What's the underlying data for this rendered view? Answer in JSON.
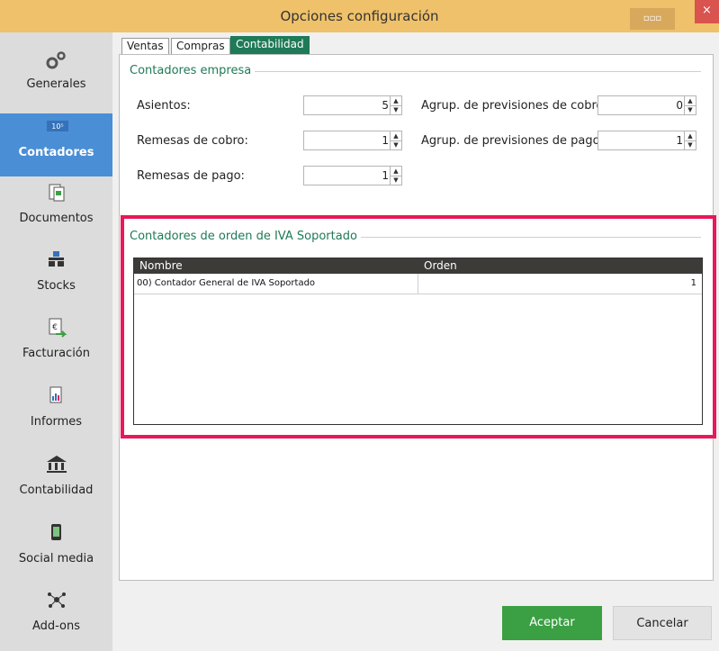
{
  "window": {
    "title": "Opciones configuración",
    "close_glyph": "×",
    "minimize_glyph": "▫▫▫"
  },
  "sidebar": {
    "items": [
      {
        "label": "Generales",
        "icon": "gears-icon"
      },
      {
        "label": "Contadores",
        "icon": "counter-icon",
        "active": true
      },
      {
        "label": "Documentos",
        "icon": "documents-icon"
      },
      {
        "label": "Stocks",
        "icon": "stocks-icon"
      },
      {
        "label": "Facturación",
        "icon": "invoice-icon"
      },
      {
        "label": "Informes",
        "icon": "report-icon"
      },
      {
        "label": "Contabilidad",
        "icon": "bank-icon"
      },
      {
        "label": "Social media",
        "icon": "phone-icon"
      },
      {
        "label": "Add-ons",
        "icon": "network-icon"
      }
    ],
    "counter_icon_text": "10⁵"
  },
  "tabs": [
    {
      "label": "Ventas",
      "active": false
    },
    {
      "label": "Compras",
      "active": false
    },
    {
      "label": "Contabilidad",
      "active": true
    }
  ],
  "contadores_empresa": {
    "title": "Contadores empresa",
    "fields": {
      "asientos": {
        "label": "Asientos:",
        "value": "5"
      },
      "remesas_cobro": {
        "label": "Remesas de cobro:",
        "value": "1"
      },
      "remesas_pago": {
        "label": "Remesas de pago:",
        "value": "1"
      },
      "agrup_cobro": {
        "label": "Agrup. de previsiones de cobro:",
        "value": "0"
      },
      "agrup_pago": {
        "label": "Agrup. de previsiones de pago:",
        "value": "1"
      }
    }
  },
  "iva_soportado": {
    "title": "Contadores de orden de IVA Soportado",
    "columns": [
      "Nombre",
      "Orden"
    ],
    "rows": [
      {
        "nombre": "00) Contador General de IVA Soportado",
        "orden": "1"
      }
    ]
  },
  "footer": {
    "accept_label": "Aceptar",
    "cancel_label": "Cancelar"
  },
  "colors": {
    "accent": "#1f7a57",
    "highlight": "#e8185a",
    "accept": "#3aa043",
    "active_nav": "#4a8ed6"
  }
}
